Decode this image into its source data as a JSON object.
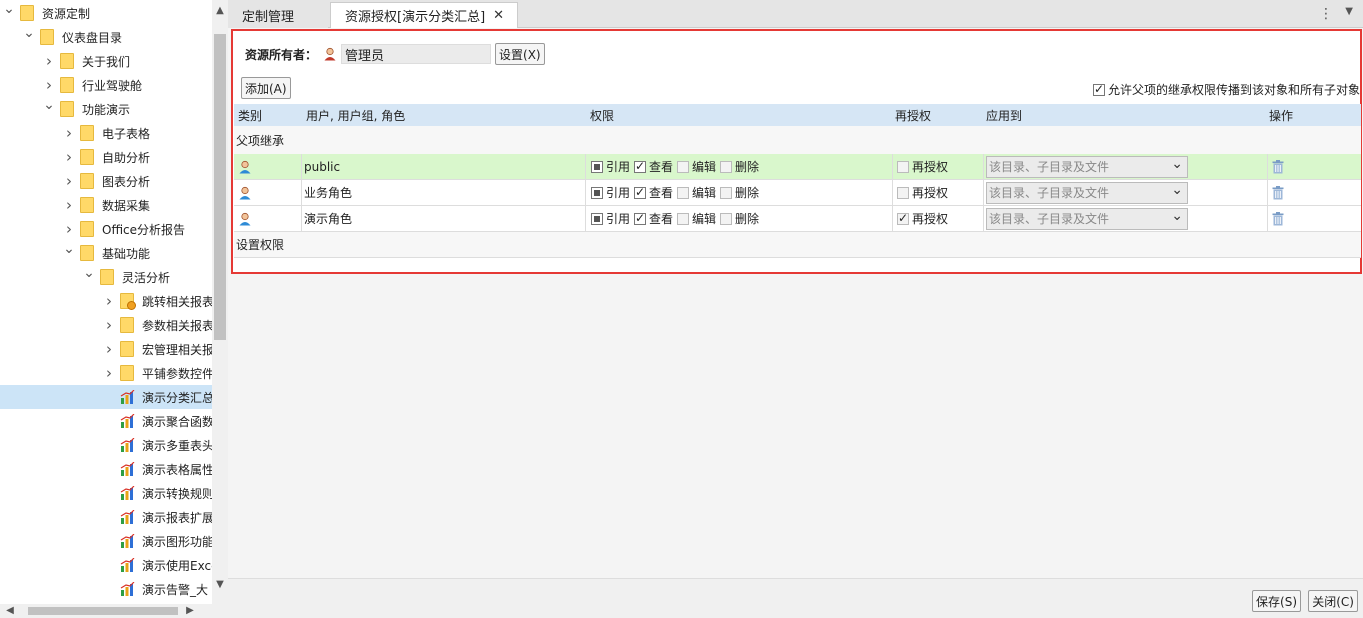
{
  "tree": {
    "nodes": [
      {
        "label": "资源定制",
        "depth": 0,
        "expander": "down",
        "icon": "folder"
      },
      {
        "label": "仪表盘目录",
        "depth": 1,
        "expander": "down",
        "icon": "folder"
      },
      {
        "label": "关于我们",
        "depth": 2,
        "expander": "right",
        "icon": "folder"
      },
      {
        "label": "行业驾驶舱",
        "depth": 2,
        "expander": "right",
        "icon": "folder"
      },
      {
        "label": "功能演示",
        "depth": 2,
        "expander": "down",
        "icon": "folder"
      },
      {
        "label": "电子表格",
        "depth": 3,
        "expander": "right",
        "icon": "folder"
      },
      {
        "label": "自助分析",
        "depth": 3,
        "expander": "right",
        "icon": "folder"
      },
      {
        "label": "图表分析",
        "depth": 3,
        "expander": "right",
        "icon": "folder"
      },
      {
        "label": "数据采集",
        "depth": 3,
        "expander": "right",
        "icon": "folder"
      },
      {
        "label": "Office分析报告",
        "depth": 3,
        "expander": "right",
        "icon": "folder"
      },
      {
        "label": "基础功能",
        "depth": 3,
        "expander": "down",
        "icon": "folder"
      },
      {
        "label": "灵活分析",
        "depth": 4,
        "expander": "down",
        "icon": "folder"
      },
      {
        "label": "跳转相关报表",
        "depth": 5,
        "expander": "right",
        "icon": "folder-lock"
      },
      {
        "label": "参数相关报表",
        "depth": 5,
        "expander": "right",
        "icon": "folder"
      },
      {
        "label": "宏管理相关报",
        "depth": 5,
        "expander": "right",
        "icon": "folder"
      },
      {
        "label": "平铺参数控件",
        "depth": 5,
        "expander": "right",
        "icon": "folder"
      },
      {
        "label": "演示分类汇总",
        "depth": 5,
        "expander": "none",
        "icon": "report",
        "selected": true
      },
      {
        "label": "演示聚合函数",
        "depth": 5,
        "expander": "none",
        "icon": "report"
      },
      {
        "label": "演示多重表头",
        "depth": 5,
        "expander": "none",
        "icon": "report"
      },
      {
        "label": "演示表格属性",
        "depth": 5,
        "expander": "none",
        "icon": "report"
      },
      {
        "label": "演示转换规则",
        "depth": 5,
        "expander": "none",
        "icon": "report"
      },
      {
        "label": "演示报表扩展",
        "depth": 5,
        "expander": "none",
        "icon": "report"
      },
      {
        "label": "演示图形功能",
        "depth": 5,
        "expander": "none",
        "icon": "report"
      },
      {
        "label": "演示使用Exce",
        "depth": 5,
        "expander": "none",
        "icon": "report"
      },
      {
        "label": "演示告警_大",
        "depth": 5,
        "expander": "none",
        "icon": "report"
      }
    ]
  },
  "tabs": {
    "tab1": "定制管理",
    "tab2": "资源授权[演示分类汇总]",
    "close": "✕",
    "menu": "⋮",
    "dropdown": "▼"
  },
  "owner": {
    "label": "资源所有者：",
    "value": "管理员",
    "set_button": "设置(X)"
  },
  "add_button": "添加(A)",
  "inherit_option": {
    "label": "允许父项的继承权限传播到该对象和所有子对象",
    "checked": true
  },
  "grid": {
    "headers": {
      "category": "类别",
      "user": "用户, 用户组, 角色",
      "permission": "权限",
      "regrant": "再授权",
      "apply_to": "应用到",
      "action": "操作"
    },
    "section_inherited": "父项继承",
    "section_set": "设置权限",
    "permission_labels": {
      "ref": "引用",
      "view": "查看",
      "edit": "编辑",
      "delete": "删除"
    },
    "regrant_label": "再授权",
    "rows": [
      {
        "name": "public",
        "ref": "partial",
        "view": "checked",
        "edit": "dis",
        "delete": "dis",
        "regrant": "dis",
        "apply": "该目录、子目录及文件",
        "highlight": true
      },
      {
        "name": "业务角色",
        "ref": "partial",
        "view": "checked",
        "edit": "dis",
        "delete": "dis",
        "regrant": "dis",
        "apply": "该目录、子目录及文件",
        "highlight": false
      },
      {
        "name": "演示角色",
        "ref": "partial",
        "view": "checked",
        "edit": "dis",
        "delete": "dis",
        "regrant": "checked-dis",
        "apply": "该目录、子目录及文件",
        "highlight": false
      }
    ]
  },
  "footer": {
    "save": "保存(S)",
    "close": "关闭(C)"
  },
  "colors": {
    "highlight_border": "#e53935",
    "header_bg": "#d6e6f5",
    "row_highlight": "#d9f7cc",
    "selection": "#cce4f7"
  }
}
